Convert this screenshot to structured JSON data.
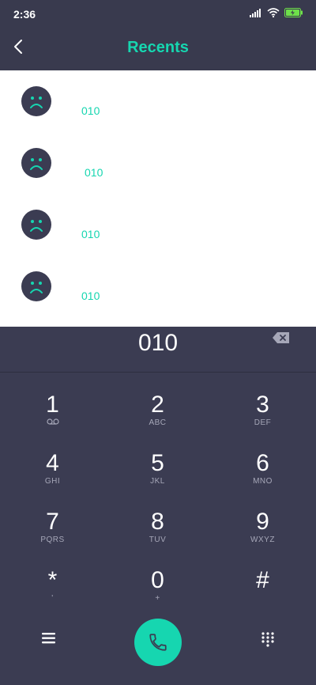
{
  "status": {
    "time": "2:36"
  },
  "header": {
    "title": "Recents"
  },
  "recents": [
    {
      "number": "010"
    },
    {
      "number": "010"
    },
    {
      "number": "010"
    },
    {
      "number": "010"
    }
  ],
  "dialer": {
    "display_number": "010"
  },
  "keys": [
    {
      "digit": "1",
      "letters": ""
    },
    {
      "digit": "2",
      "letters": "ABC"
    },
    {
      "digit": "3",
      "letters": "DEF"
    },
    {
      "digit": "4",
      "letters": "GHI"
    },
    {
      "digit": "5",
      "letters": "JKL"
    },
    {
      "digit": "6",
      "letters": "MNO"
    },
    {
      "digit": "7",
      "letters": "PQRS"
    },
    {
      "digit": "8",
      "letters": "TUV"
    },
    {
      "digit": "9",
      "letters": "WXYZ"
    },
    {
      "digit": "*",
      "letters": "'"
    },
    {
      "digit": "0",
      "letters": "+"
    },
    {
      "digit": "#",
      "letters": ""
    }
  ],
  "icons": {
    "voicemail": "voicemail-icon",
    "back": "back-arrow-icon",
    "backspace": "backspace-icon",
    "call": "phone-icon",
    "menu": "menu-icon",
    "dialpad": "dialpad-icon",
    "avatar": "sad-face-icon"
  },
  "colors": {
    "accent": "#16d6b0",
    "background": "#3b3c52",
    "list_background": "#ffffff"
  }
}
